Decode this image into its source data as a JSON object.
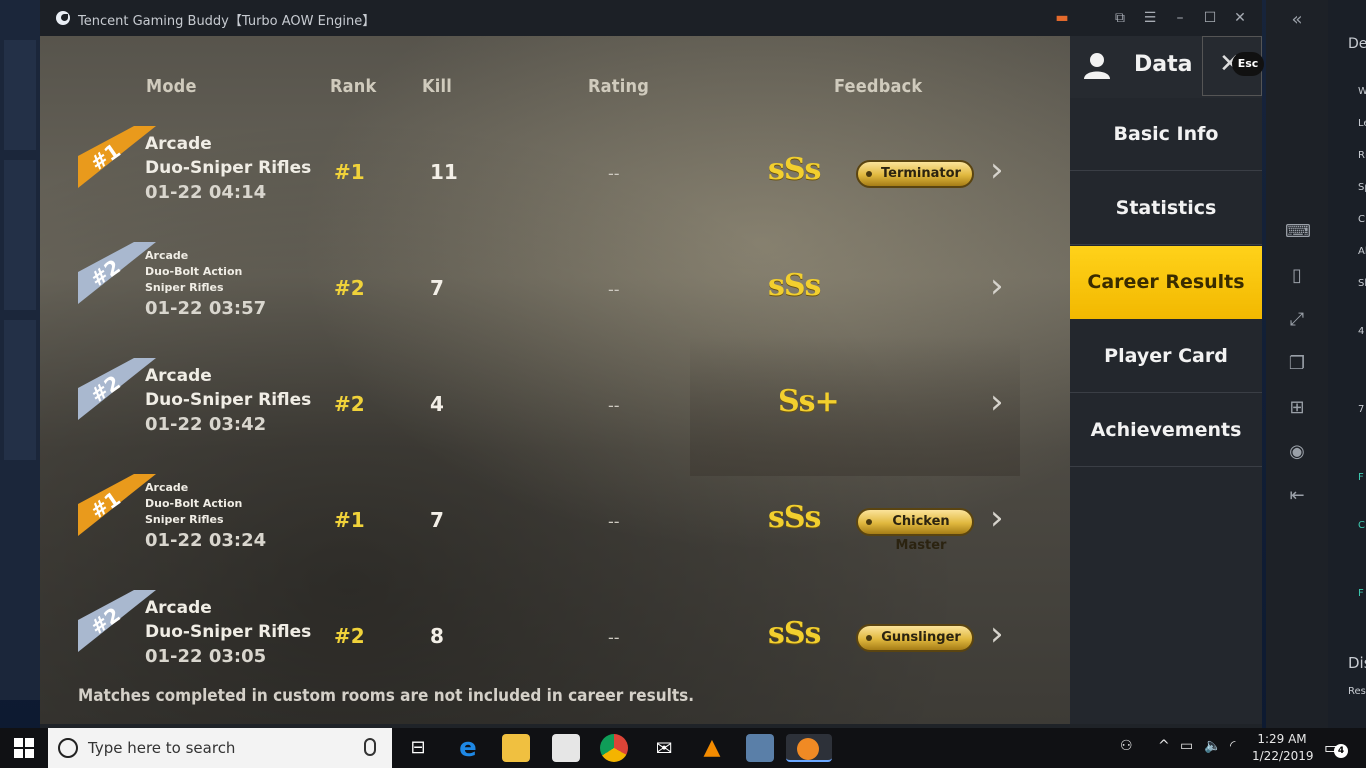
{
  "window": {
    "title": "Tencent Gaming Buddy【Turbo AOW Engine】"
  },
  "table": {
    "headers": {
      "mode": "Mode",
      "rank": "Rank",
      "kill": "Kill",
      "rating": "Rating",
      "feedback": "Feedback"
    },
    "rows": [
      {
        "ribbon": "#1",
        "ribbon_color": "#e99a1c",
        "mode_lines": [
          "Arcade",
          "Duo-Sniper Rifles"
        ],
        "mode_size": "big",
        "date": "01-22 04:14",
        "rank": "#1",
        "kill": "11",
        "rating": "--",
        "score": "sSs",
        "badge": "Terminator"
      },
      {
        "ribbon": "#2",
        "ribbon_color": "#a9b8cf",
        "mode_lines": [
          "Arcade",
          "Duo-Bolt Action",
          "Sniper Rifles"
        ],
        "mode_size": "small",
        "date": "01-22 03:57",
        "rank": "#2",
        "kill": "7",
        "rating": "--",
        "score": "sSs",
        "badge": ""
      },
      {
        "ribbon": "#2",
        "ribbon_color": "#a9b8cf",
        "mode_lines": [
          "Arcade",
          "Duo-Sniper Rifles"
        ],
        "mode_size": "big",
        "date": "01-22 03:42",
        "rank": "#2",
        "kill": "4",
        "rating": "--",
        "score": "Ss+",
        "badge": ""
      },
      {
        "ribbon": "#1",
        "ribbon_color": "#e99a1c",
        "mode_lines": [
          "Arcade",
          "Duo-Bolt Action",
          "Sniper Rifles"
        ],
        "mode_size": "small",
        "date": "01-22 03:24",
        "rank": "#1",
        "kill": "7",
        "rating": "--",
        "score": "sSs",
        "badge": "Chicken Master"
      },
      {
        "ribbon": "#2",
        "ribbon_color": "#a9b8cf",
        "mode_lines": [
          "Arcade",
          "Duo-Sniper Rifles"
        ],
        "mode_size": "big",
        "date": "01-22 03:05",
        "rank": "#2",
        "kill": "8",
        "rating": "--",
        "score": "sSs",
        "badge": "Gunslinger"
      }
    ]
  },
  "footnote": "Matches completed in custom rooms are not included in career results.",
  "menu": {
    "title": "Data",
    "esc": "Esc",
    "items": [
      {
        "label": "Basic Info",
        "active": false
      },
      {
        "label": "Statistics",
        "active": false
      },
      {
        "label": "Career Results",
        "active": true
      },
      {
        "label": "Player Card",
        "active": false
      },
      {
        "label": "Achievements",
        "active": false
      }
    ]
  },
  "colors": {
    "gold": "#f0d23a",
    "active_menu": "#ffd21a",
    "rank1_ribbon": "#e99a1c",
    "rank2_ribbon": "#a9b8cf"
  },
  "taskbar": {
    "search_placeholder": "Type here to search",
    "time": "1:29 AM",
    "date": "1/22/2019",
    "notifications": "4"
  },
  "right_app": {
    "labels": [
      "De",
      "W",
      "Le",
      "Ri",
      "Sp",
      "C",
      "Al",
      "Sh",
      "4",
      "7",
      "F",
      "C",
      "F",
      "Dis",
      "Res"
    ]
  }
}
